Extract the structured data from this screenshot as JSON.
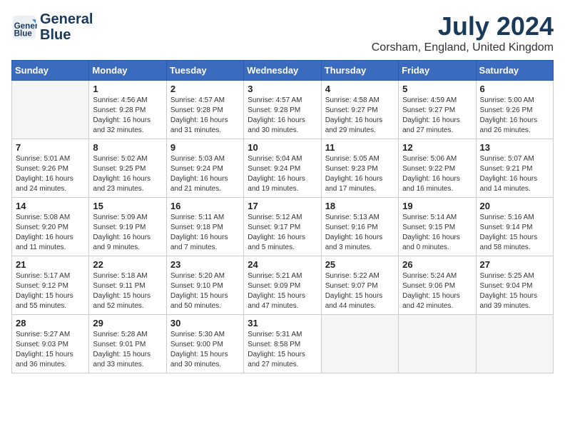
{
  "header": {
    "logo_line1": "General",
    "logo_line2": "Blue",
    "title": "July 2024",
    "subtitle": "Corsham, England, United Kingdom"
  },
  "weekdays": [
    "Sunday",
    "Monday",
    "Tuesday",
    "Wednesday",
    "Thursday",
    "Friday",
    "Saturday"
  ],
  "weeks": [
    [
      {
        "day": "",
        "empty": true
      },
      {
        "day": "1",
        "sunrise": "4:56 AM",
        "sunset": "9:28 PM",
        "daylight": "16 hours and 32 minutes."
      },
      {
        "day": "2",
        "sunrise": "4:57 AM",
        "sunset": "9:28 PM",
        "daylight": "16 hours and 31 minutes."
      },
      {
        "day": "3",
        "sunrise": "4:57 AM",
        "sunset": "9:28 PM",
        "daylight": "16 hours and 30 minutes."
      },
      {
        "day": "4",
        "sunrise": "4:58 AM",
        "sunset": "9:27 PM",
        "daylight": "16 hours and 29 minutes."
      },
      {
        "day": "5",
        "sunrise": "4:59 AM",
        "sunset": "9:27 PM",
        "daylight": "16 hours and 27 minutes."
      },
      {
        "day": "6",
        "sunrise": "5:00 AM",
        "sunset": "9:26 PM",
        "daylight": "16 hours and 26 minutes."
      }
    ],
    [
      {
        "day": "7",
        "sunrise": "5:01 AM",
        "sunset": "9:26 PM",
        "daylight": "16 hours and 24 minutes."
      },
      {
        "day": "8",
        "sunrise": "5:02 AM",
        "sunset": "9:25 PM",
        "daylight": "16 hours and 23 minutes."
      },
      {
        "day": "9",
        "sunrise": "5:03 AM",
        "sunset": "9:24 PM",
        "daylight": "16 hours and 21 minutes."
      },
      {
        "day": "10",
        "sunrise": "5:04 AM",
        "sunset": "9:24 PM",
        "daylight": "16 hours and 19 minutes."
      },
      {
        "day": "11",
        "sunrise": "5:05 AM",
        "sunset": "9:23 PM",
        "daylight": "16 hours and 17 minutes."
      },
      {
        "day": "12",
        "sunrise": "5:06 AM",
        "sunset": "9:22 PM",
        "daylight": "16 hours and 16 minutes."
      },
      {
        "day": "13",
        "sunrise": "5:07 AM",
        "sunset": "9:21 PM",
        "daylight": "16 hours and 14 minutes."
      }
    ],
    [
      {
        "day": "14",
        "sunrise": "5:08 AM",
        "sunset": "9:20 PM",
        "daylight": "16 hours and 11 minutes."
      },
      {
        "day": "15",
        "sunrise": "5:09 AM",
        "sunset": "9:19 PM",
        "daylight": "16 hours and 9 minutes."
      },
      {
        "day": "16",
        "sunrise": "5:11 AM",
        "sunset": "9:18 PM",
        "daylight": "16 hours and 7 minutes."
      },
      {
        "day": "17",
        "sunrise": "5:12 AM",
        "sunset": "9:17 PM",
        "daylight": "16 hours and 5 minutes."
      },
      {
        "day": "18",
        "sunrise": "5:13 AM",
        "sunset": "9:16 PM",
        "daylight": "16 hours and 3 minutes."
      },
      {
        "day": "19",
        "sunrise": "5:14 AM",
        "sunset": "9:15 PM",
        "daylight": "16 hours and 0 minutes."
      },
      {
        "day": "20",
        "sunrise": "5:16 AM",
        "sunset": "9:14 PM",
        "daylight": "15 hours and 58 minutes."
      }
    ],
    [
      {
        "day": "21",
        "sunrise": "5:17 AM",
        "sunset": "9:12 PM",
        "daylight": "15 hours and 55 minutes."
      },
      {
        "day": "22",
        "sunrise": "5:18 AM",
        "sunset": "9:11 PM",
        "daylight": "15 hours and 52 minutes."
      },
      {
        "day": "23",
        "sunrise": "5:20 AM",
        "sunset": "9:10 PM",
        "daylight": "15 hours and 50 minutes."
      },
      {
        "day": "24",
        "sunrise": "5:21 AM",
        "sunset": "9:09 PM",
        "daylight": "15 hours and 47 minutes."
      },
      {
        "day": "25",
        "sunrise": "5:22 AM",
        "sunset": "9:07 PM",
        "daylight": "15 hours and 44 minutes."
      },
      {
        "day": "26",
        "sunrise": "5:24 AM",
        "sunset": "9:06 PM",
        "daylight": "15 hours and 42 minutes."
      },
      {
        "day": "27",
        "sunrise": "5:25 AM",
        "sunset": "9:04 PM",
        "daylight": "15 hours and 39 minutes."
      }
    ],
    [
      {
        "day": "28",
        "sunrise": "5:27 AM",
        "sunset": "9:03 PM",
        "daylight": "15 hours and 36 minutes."
      },
      {
        "day": "29",
        "sunrise": "5:28 AM",
        "sunset": "9:01 PM",
        "daylight": "15 hours and 33 minutes."
      },
      {
        "day": "30",
        "sunrise": "5:30 AM",
        "sunset": "9:00 PM",
        "daylight": "15 hours and 30 minutes."
      },
      {
        "day": "31",
        "sunrise": "5:31 AM",
        "sunset": "8:58 PM",
        "daylight": "15 hours and 27 minutes."
      },
      {
        "day": "",
        "empty": true
      },
      {
        "day": "",
        "empty": true
      },
      {
        "day": "",
        "empty": true
      }
    ]
  ]
}
